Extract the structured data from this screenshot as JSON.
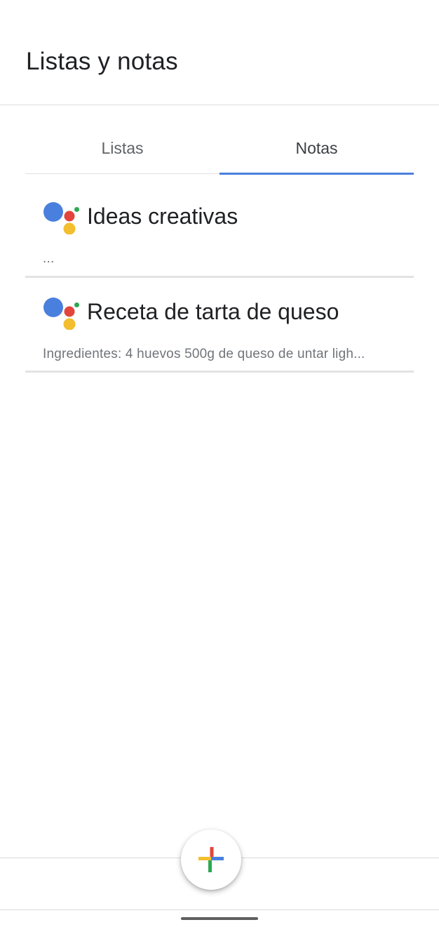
{
  "header": {
    "title": "Listas y notas"
  },
  "tabs": [
    {
      "label": "Listas",
      "active": false
    },
    {
      "label": "Notas",
      "active": true
    }
  ],
  "notes": [
    {
      "title": "Ideas creativas",
      "preview": "...",
      "icon": "google-assistant-icon"
    },
    {
      "title": "Receta de tarta de queso",
      "preview": "Ingredientes: 4 huevos 500g de queso de untar ligh...",
      "icon": "google-assistant-icon"
    }
  ],
  "fab": {
    "icon": "add-icon"
  },
  "colors": {
    "accent": "#4a80dd",
    "assistant_blue": "#4285f4",
    "assistant_red": "#ea4335",
    "assistant_yellow": "#fbbc05",
    "assistant_green": "#34a853"
  }
}
